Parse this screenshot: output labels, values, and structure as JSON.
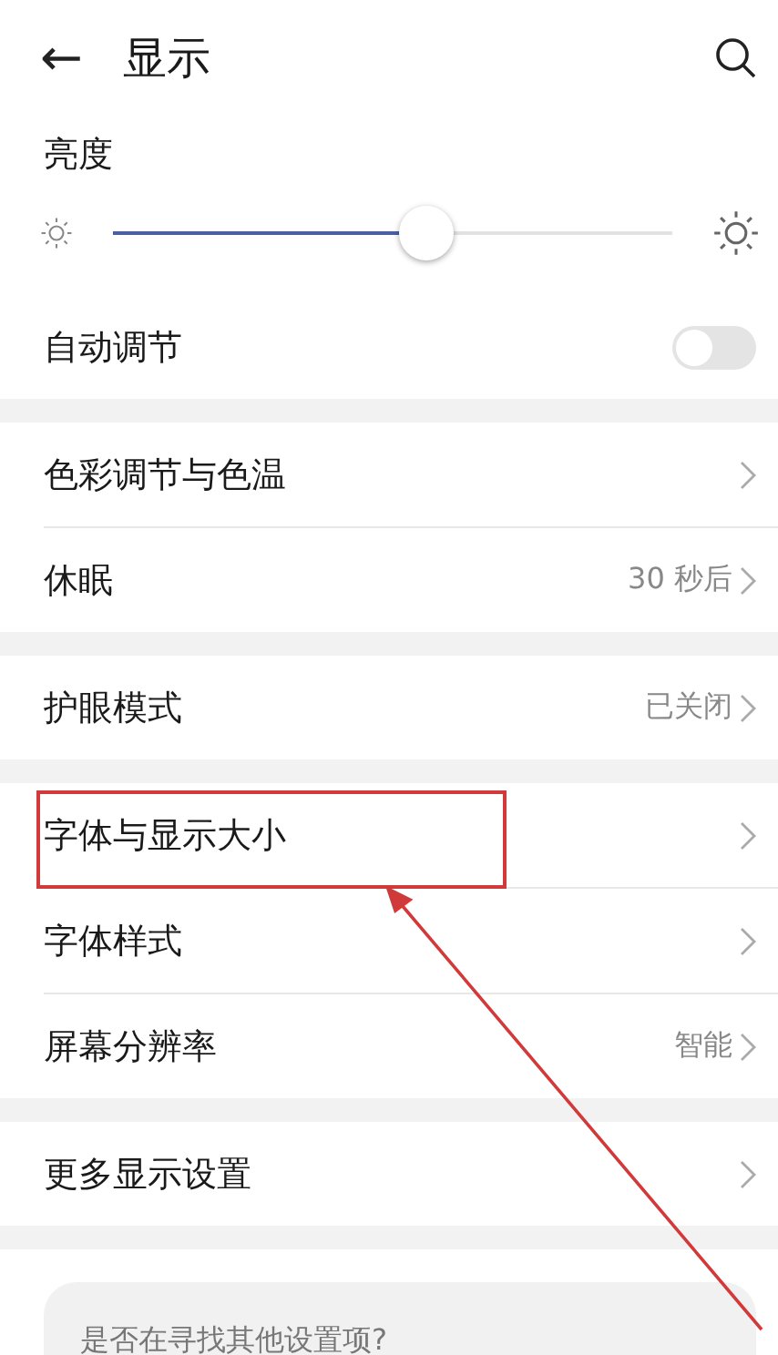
{
  "header": {
    "back": "←",
    "title": "显示"
  },
  "brightness": {
    "label": "亮度",
    "level": 0.56
  },
  "groups": [
    {
      "rows": [
        {
          "kind": "toggle",
          "label": "自动调节",
          "on": false,
          "highlighted": false
        }
      ]
    },
    {
      "rows": [
        {
          "kind": "link",
          "label": "色彩调节与色温",
          "highlighted": false
        },
        {
          "kind": "link",
          "label": "休眠",
          "value": "30 秒后",
          "highlighted": false
        }
      ]
    },
    {
      "rows": [
        {
          "kind": "link",
          "label": "护眼模式",
          "value": "已关闭",
          "highlighted": false
        }
      ]
    },
    {
      "rows": [
        {
          "kind": "link",
          "label": "字体与显示大小",
          "highlighted": true
        },
        {
          "kind": "link",
          "label": "字体样式",
          "highlighted": false
        },
        {
          "kind": "link",
          "label": "屏幕分辨率",
          "value": "智能",
          "highlighted": false
        }
      ]
    },
    {
      "rows": [
        {
          "kind": "link",
          "label": "更多显示设置",
          "highlighted": false
        }
      ]
    }
  ],
  "suggestion": {
    "title": "是否在寻找其他设置项?"
  }
}
